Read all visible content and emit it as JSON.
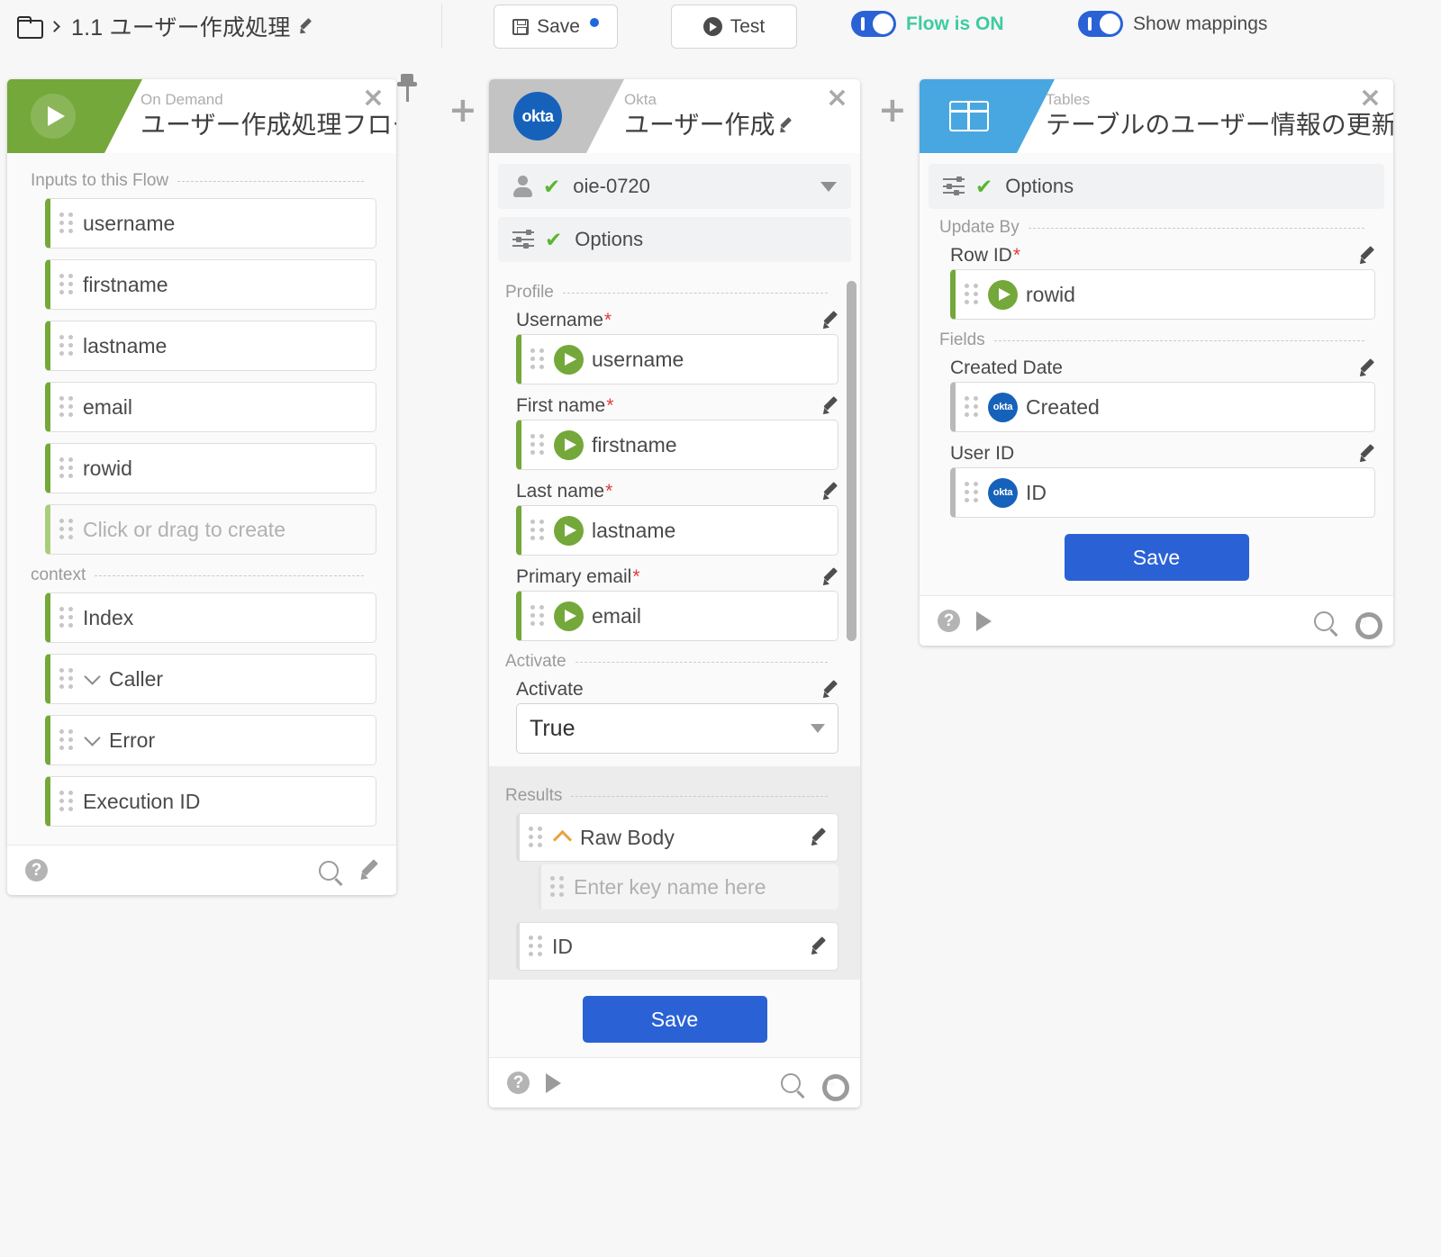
{
  "topbar": {
    "breadcrumb_title": "1.1 ユーザー作成処理",
    "save_label": "Save",
    "test_label": "Test",
    "flow_toggle_label": "Flow is ON",
    "mappings_toggle_label": "Show mappings",
    "accent_blue": "#2a62d6",
    "on_green": "#3ecba0"
  },
  "cards": [
    {
      "id": "trigger-card",
      "subtitle": "On Demand",
      "title": "ユーザー作成処理フロー",
      "header_color": "#74a83a",
      "sections": [
        {
          "label": "Inputs to this Flow",
          "rows": [
            {
              "text": "username",
              "kind": "pill"
            },
            {
              "text": "firstname",
              "kind": "pill"
            },
            {
              "text": "lastname",
              "kind": "pill"
            },
            {
              "text": "email",
              "kind": "pill"
            },
            {
              "text": "rowid",
              "kind": "pill"
            },
            {
              "text": "Click or drag to create",
              "kind": "ghost"
            }
          ]
        },
        {
          "label": "context",
          "rows": [
            {
              "text": "Index",
              "kind": "pill"
            },
            {
              "text": "Caller",
              "kind": "expandable"
            },
            {
              "text": "Error",
              "kind": "expandable"
            },
            {
              "text": "Execution ID",
              "kind": "pill"
            }
          ]
        }
      ]
    },
    {
      "id": "okta-card",
      "subtitle": "Okta",
      "title": "ユーザー作成",
      "header_color": "#c3c3c3",
      "connection": "oie-0720",
      "options_label": "Options",
      "profile_label": "Profile",
      "profile_fields": [
        {
          "label": "Username",
          "required": true,
          "value": "username",
          "source": "flow"
        },
        {
          "label": "First name",
          "required": true,
          "value": "firstname",
          "source": "flow"
        },
        {
          "label": "Last name",
          "required": true,
          "value": "lastname",
          "source": "flow"
        },
        {
          "label": "Primary email",
          "required": true,
          "value": "email",
          "source": "flow"
        }
      ],
      "activate_section_label": "Activate",
      "activate_field_label": "Activate",
      "activate_value": "True",
      "results_label": "Results",
      "results": [
        {
          "text": "Raw Body",
          "kind": "expandable-up"
        },
        {
          "text": "Enter key name here",
          "kind": "subkey-placeholder"
        },
        {
          "text": "ID",
          "kind": "result"
        }
      ],
      "save_label": "Save"
    },
    {
      "id": "tables-card",
      "subtitle": "Tables",
      "title": "テーブルのユーザー情報の更新",
      "header_color": "#48a7e0",
      "options_label": "Options",
      "update_by_label": "Update By",
      "update_by_fields": [
        {
          "label": "Row ID",
          "required": true,
          "value": "rowid",
          "source": "flow"
        }
      ],
      "fields_label": "Fields",
      "fields": [
        {
          "label": "Created Date",
          "required": false,
          "value": "Created",
          "source": "okta"
        },
        {
          "label": "User ID",
          "required": false,
          "value": "ID",
          "source": "okta"
        }
      ],
      "save_label": "Save"
    }
  ],
  "icons": {
    "okta_badge_text": "okta",
    "add_step": "+",
    "close": "×",
    "help": "?"
  }
}
